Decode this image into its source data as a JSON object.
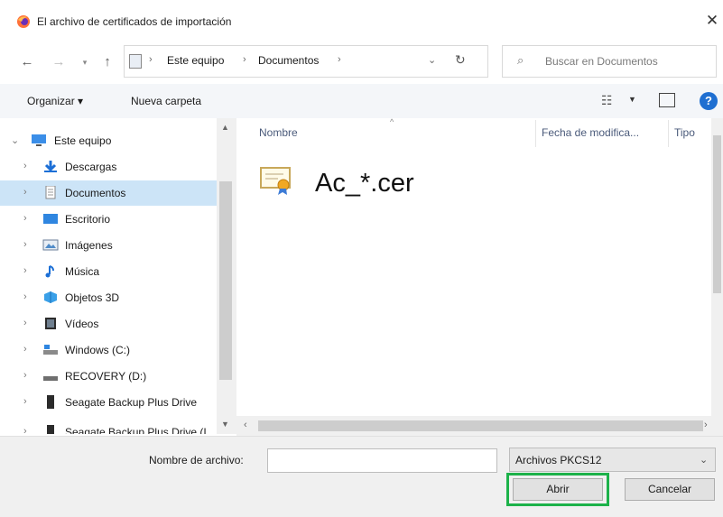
{
  "window": {
    "title": "El archivo de certificados de importación",
    "close_label": "✕"
  },
  "address": {
    "crumbs": [
      "Este equipo",
      "Documentos"
    ],
    "search_placeholder": "Buscar en Documentos"
  },
  "toolbar": {
    "organize_label": "Organizar ▾",
    "new_folder_label": "Nueva carpeta"
  },
  "nav": {
    "items": [
      {
        "label": "Este equipo",
        "icon": "computer-icon"
      },
      {
        "label": "Descargas",
        "icon": "downloads-icon"
      },
      {
        "label": "Documentos",
        "icon": "documents-icon",
        "selected": true
      },
      {
        "label": "Escritorio",
        "icon": "desktop-icon"
      },
      {
        "label": "Imágenes",
        "icon": "pictures-icon"
      },
      {
        "label": "Música",
        "icon": "music-icon"
      },
      {
        "label": "Objetos 3D",
        "icon": "objects3d-icon"
      },
      {
        "label": "Vídeos",
        "icon": "videos-icon"
      },
      {
        "label": "Windows (C:)",
        "icon": "drive-c-icon"
      },
      {
        "label": "RECOVERY (D:)",
        "icon": "drive-d-icon"
      },
      {
        "label": "Seagate Backup Plus Drive",
        "icon": "external-drive-icon"
      },
      {
        "label": "Seagate Backup Plus Drive (I",
        "icon": "external-drive-icon"
      }
    ]
  },
  "files": {
    "columns": [
      "Nombre",
      "Fecha de modifica...",
      "Tipo"
    ],
    "items": [
      {
        "name": "Ac_*.cer",
        "icon": "certificate-icon"
      }
    ]
  },
  "bottom": {
    "filename_label": "Nombre de archivo:",
    "filename_value": "",
    "filetype_value": "Archivos PKCS12",
    "open_label": "Abrir",
    "cancel_label": "Cancelar"
  },
  "colors": {
    "selected_bg": "#cce4f7",
    "highlight_border": "#1db24a",
    "help_blue": "#1f6fd1"
  }
}
